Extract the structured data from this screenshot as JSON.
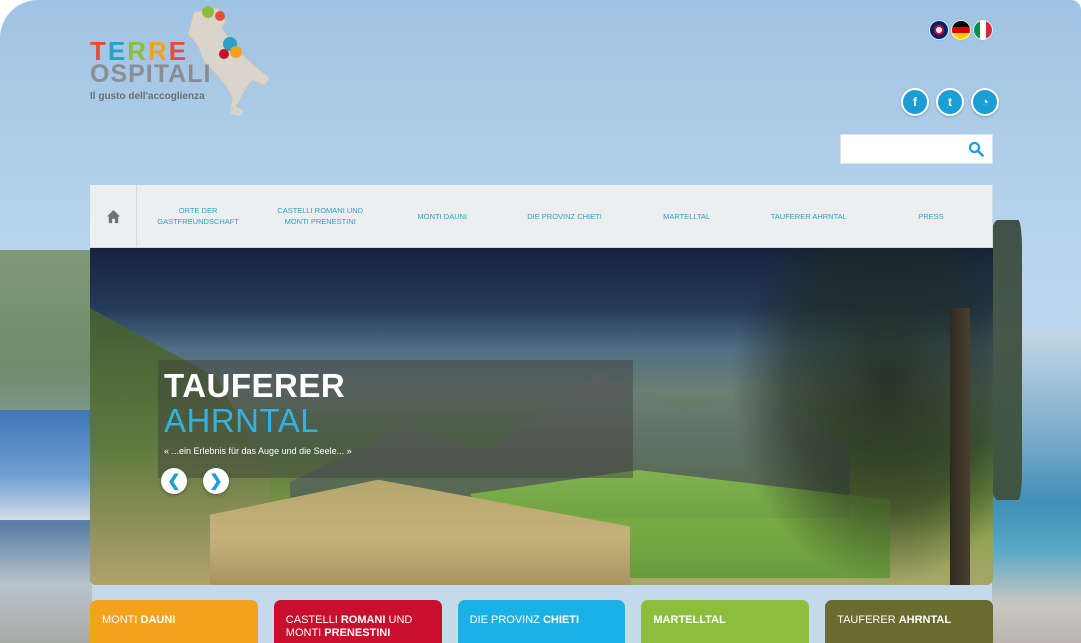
{
  "logo": {
    "letters_terre": [
      "T",
      "E",
      "R",
      "R",
      "E"
    ],
    "line2": "OSPITALI",
    "tagline": "Il gusto dell'accoglienza"
  },
  "languages": [
    "en",
    "de",
    "it"
  ],
  "social": [
    {
      "icon": "facebook-icon",
      "glyph": "f"
    },
    {
      "icon": "twitter-icon",
      "glyph": "t"
    },
    {
      "icon": "rss-icon",
      "glyph": "◔"
    }
  ],
  "search": {
    "placeholder": ""
  },
  "nav": {
    "home_icon": "home-icon",
    "items": [
      "Orte der\nGastfreundschaft",
      "Castelli Romani und\nMonti Prenestini",
      "Monti Dauni",
      "Die Provinz Chieti",
      "Martelltal",
      "Tauferer Ahrntal",
      "Press"
    ]
  },
  "hero": {
    "title_line1": "TAUFERER",
    "title_line2": "AHRNTAL",
    "subtitle": "« ...ein Erlebnis für das Auge und die Seele... »"
  },
  "tabs": [
    {
      "pre": "Monti ",
      "bold": "Dauni",
      "mid": "",
      "bold2": "",
      "color": "#f2a31b"
    },
    {
      "pre": "Castelli ",
      "bold": "Romani",
      "mid": " und Monti ",
      "bold2": "Prenestini",
      "color": "#c8102e"
    },
    {
      "pre": "Die Provinz ",
      "bold": "Chieti",
      "mid": "",
      "bold2": "",
      "color": "#1ab1e6"
    },
    {
      "pre": "",
      "bold": "Martelltal",
      "mid": "",
      "bold2": "",
      "color": "#8dbd3c"
    },
    {
      "pre": "Tauferer ",
      "bold": "Ahrntal",
      "mid": "",
      "bold2": "",
      "color": "#6a6b2f"
    }
  ],
  "colors": {
    "accent": "#2aa1c9",
    "social_bg": "#1a9ed3",
    "nav_bg": "#eceeef",
    "logo_letters": [
      "#e84b3a",
      "#2aa1c9",
      "#8dbd3c",
      "#f2a31b",
      "#e84b3a"
    ]
  }
}
